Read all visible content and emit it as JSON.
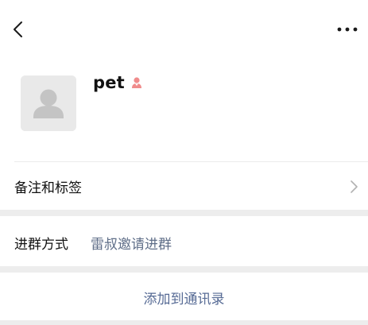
{
  "nav": {
    "back_icon": "chevron-left-icon",
    "more_icon": "more-horizontal-icon"
  },
  "profile": {
    "name": "pet",
    "avatar_icon": "default-avatar-icon",
    "gender_icon": "female-gender-icon",
    "gender_color": "#f08c8c"
  },
  "remark": {
    "label": "备注和标签",
    "arrow_icon": "chevron-right-icon"
  },
  "join": {
    "label": "进群方式",
    "value": "雷叔邀请进群"
  },
  "actions": {
    "add_contact_label": "添加到通讯录",
    "link_color": "#576b95"
  }
}
